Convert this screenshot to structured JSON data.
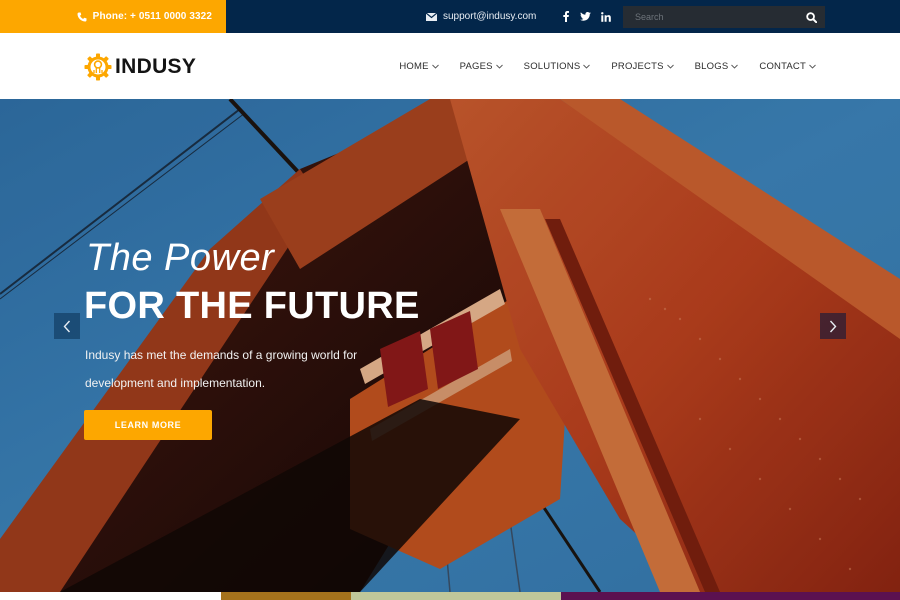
{
  "topbar": {
    "phone_icon": "phone-icon",
    "phone_text": "Phone: + 0511 0000 3322",
    "email_icon": "envelope-icon",
    "email_text": "support@indusy.com",
    "social": [
      {
        "name": "facebook-icon",
        "glyph": "f"
      },
      {
        "name": "twitter-icon",
        "glyph": "t"
      },
      {
        "name": "linkedin-icon",
        "glyph": "in"
      }
    ],
    "search": {
      "placeholder": "Search",
      "value": "",
      "button_icon": "search-icon"
    }
  },
  "header": {
    "logo_text": "INDUSY",
    "logo_icon": "gear-bulb-icon",
    "nav": [
      {
        "label": "HOME",
        "icon": "chevron-down-icon"
      },
      {
        "label": "PAGES",
        "icon": "chevron-down-icon"
      },
      {
        "label": "SOLUTIONS",
        "icon": "chevron-down-icon"
      },
      {
        "label": "PROJECTS",
        "icon": "chevron-down-icon"
      },
      {
        "label": "BLOGS",
        "icon": "chevron-down-icon"
      },
      {
        "label": "CONTACT",
        "icon": "chevron-down-icon"
      }
    ]
  },
  "hero": {
    "kicker": "The Power",
    "headline": "FOR THE FUTURE",
    "description": "Indusy has met the demands of a growing world for development and implementation.",
    "cta_label": "LEARN MORE",
    "prev_icon": "chevron-left-icon",
    "next_icon": "chevron-right-icon"
  },
  "colors": {
    "accent": "#fda700",
    "topbar_bg": "#03264a",
    "search_bg": "#262c33",
    "text_dark": "#141414",
    "sky": "#3a7fb3",
    "steel_red": "#b8401e"
  }
}
